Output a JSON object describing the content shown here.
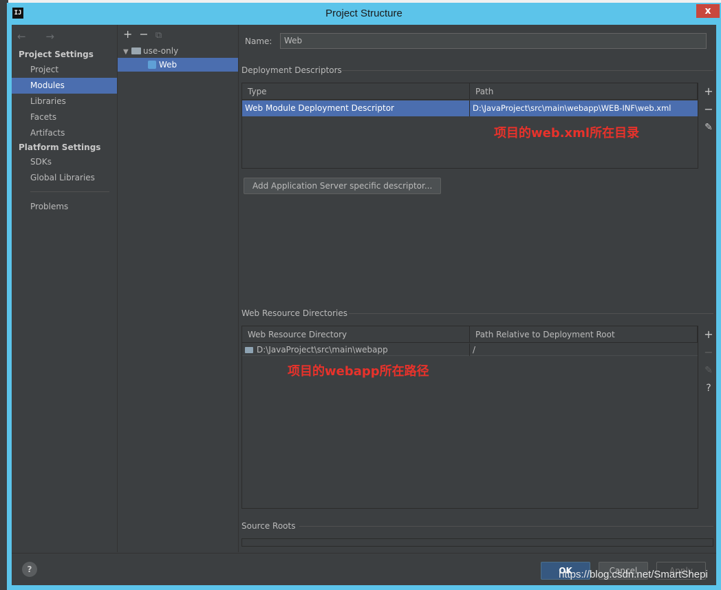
{
  "window": {
    "title": "Project Structure",
    "close_label": "x",
    "app_icon_label": "IJ"
  },
  "nav": {
    "back_arrows": "← →",
    "project_settings_heading": "Project Settings",
    "project_items": [
      "Project",
      "Modules",
      "Libraries",
      "Facets",
      "Artifacts"
    ],
    "selected": "Modules",
    "platform_settings_heading": "Platform Settings",
    "platform_items": [
      "SDKs",
      "Global Libraries"
    ],
    "problems": "Problems"
  },
  "tree": {
    "toolbar": {
      "add": "+",
      "remove": "−",
      "copy": "⧉"
    },
    "root": "use-only",
    "child": "Web"
  },
  "content": {
    "name_label": "Name:",
    "name_value": "Web",
    "deployment_descriptors": {
      "heading": "Deployment Descriptors",
      "col_type": "Type",
      "col_path": "Path",
      "row_type": "Web Module Deployment Descriptor",
      "row_path": "D:\\JavaProject\\src\\main\\webapp\\WEB-INF\\web.xml",
      "annotation": "项目的web.xml所在目录"
    },
    "add_descriptor_button": "Add Application Server specific descriptor...",
    "web_resource_dirs": {
      "heading": "Web Resource Directories",
      "col_dir": "Web Resource Directory",
      "col_rel": "Path Relative to Deployment Root",
      "row_dir": "D:\\JavaProject\\src\\main\\webapp",
      "row_rel": "/",
      "annotation": "项目的webapp所在路径"
    },
    "source_roots_heading": "Source Roots",
    "side_tools": {
      "add": "+",
      "remove": "−",
      "edit": "✎",
      "help": "?"
    }
  },
  "bottom": {
    "help": "?",
    "ok": "OK",
    "cancel": "Cancel",
    "apply": "Apply",
    "watermark": "https://blog.csdn.net/SmartShepi"
  },
  "colors": {
    "selection": "#4b6eaf",
    "annotation": "#e8322b",
    "titlebar": "#5cc4ea"
  }
}
